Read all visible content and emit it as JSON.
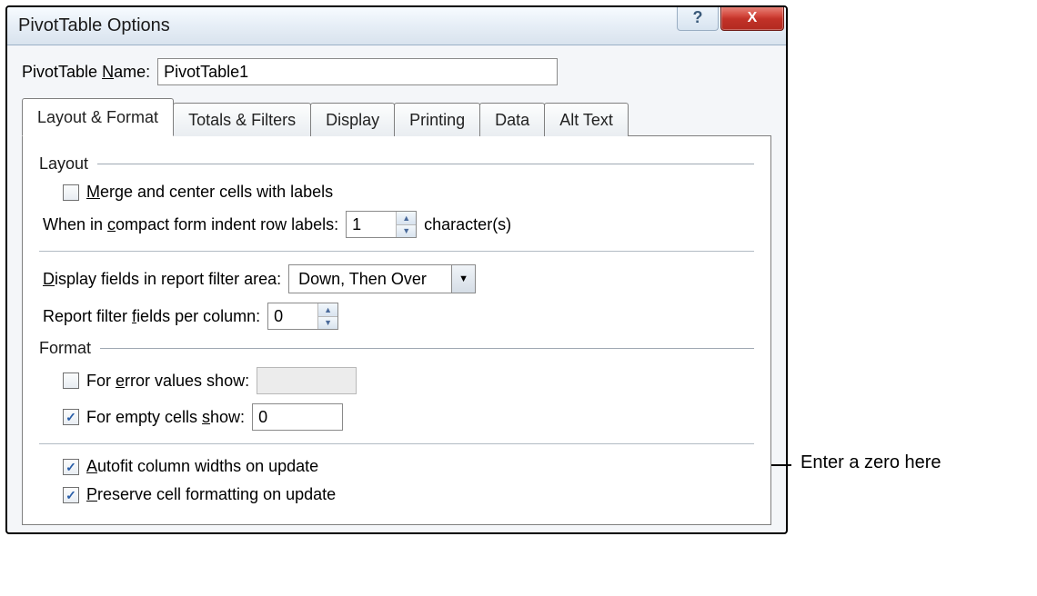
{
  "dialog": {
    "title": "PivotTable Options",
    "help_symbol": "?",
    "close_symbol": "X"
  },
  "name_row": {
    "label_pre": "PivotTable ",
    "label_u": "N",
    "label_post": "ame:",
    "value": "PivotTable1"
  },
  "tabs": {
    "t0": "Layout & Format",
    "t1": "Totals & Filters",
    "t2": "Display",
    "t3": "Printing",
    "t4": "Data",
    "t5": "Alt Text"
  },
  "layout_section": {
    "header": "Layout",
    "merge_pre": "",
    "merge_u": "M",
    "merge_post": "erge and center cells with labels",
    "indent_pre": "When in ",
    "indent_u": "c",
    "indent_post": "ompact form indent row labels:",
    "indent_value": "1",
    "indent_suffix": "character(s)",
    "display_pre": "",
    "display_u": "D",
    "display_post": "isplay fields in report filter area:",
    "display_value": "Down, Then Over",
    "perColumn_pre": "Report filter ",
    "perColumn_u": "f",
    "perColumn_post": "ields per column:",
    "perColumn_value": "0"
  },
  "format_section": {
    "header": "Format",
    "error_pre": "For ",
    "error_u": "e",
    "error_post": "rror values show:",
    "empty_pre": "For empty cells ",
    "empty_u": "s",
    "empty_post": "how:",
    "empty_value": "0",
    "autofit_u": "A",
    "autofit_post": "utofit column widths on update",
    "preserve_u": "P",
    "preserve_post": "reserve cell formatting on update"
  },
  "callout": {
    "text": "Enter a zero here"
  }
}
